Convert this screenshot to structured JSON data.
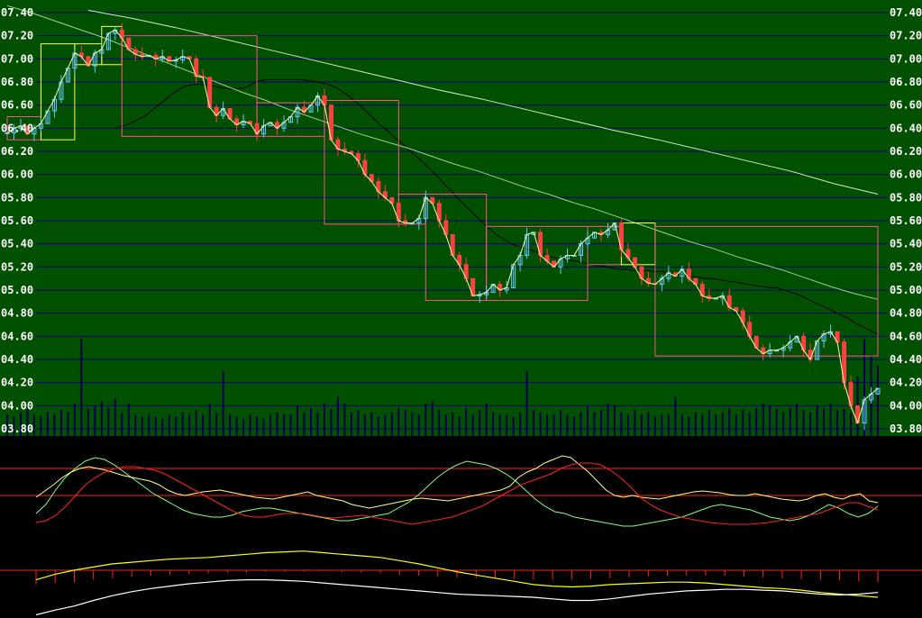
{
  "colors": {
    "price_bg": "#005000",
    "indicator_bg": "#000000",
    "gridline": "#00007a",
    "volume_bar": "#00004c",
    "candle_up": "#64c8ff",
    "candle_down": "#ff4040",
    "close_line": "#ffffa0",
    "ma_short": "#000000",
    "ma_long": "#a0d090",
    "ma_longest": "#d8e8c8",
    "box_up": "#ffff40",
    "box_down": "#ff5090",
    "kdj_k": "#ffff80",
    "kdj_d": "#ff2020",
    "kdj_j": "#80ff80",
    "macd_dif": "#ffffff",
    "macd_dea": "#ffff00",
    "macd_bar": "#ff2020",
    "ref_line": "#ff2020"
  },
  "chart_data": {
    "type": "line",
    "y_axis_left": {
      "ticks": [
        "07.40",
        "07.20",
        "07.00",
        "06.80",
        "06.60",
        "06.40",
        "06.20",
        "06.00",
        "05.80",
        "05.60",
        "05.40",
        "05.20",
        "05.00",
        "04.80",
        "04.60",
        "04.40",
        "04.20",
        "04.00",
        "03.80"
      ],
      "ylim": [
        3.8,
        7.4
      ]
    },
    "y_axis_right": {
      "ticks": [
        "07.40",
        "07.20",
        "07.00",
        "06.80",
        "06.60",
        "06.40",
        "06.20",
        "06.00",
        "05.80",
        "05.60",
        "05.40",
        "05.20",
        "05.00",
        "04.80",
        "04.60",
        "04.40",
        "04.20",
        "04.00",
        "03.80"
      ]
    },
    "grid": true,
    "close": [
      6.36,
      6.4,
      6.42,
      6.35,
      6.4,
      6.44,
      6.55,
      6.65,
      6.8,
      6.92,
      7.05,
      7.02,
      6.94,
      7.05,
      7.08,
      7.22,
      7.25,
      7.18,
      7.08,
      7.04,
      7.02,
      7.03,
      7.0,
      7.02,
      6.98,
      6.99,
      7.02,
      7.0,
      6.85,
      6.84,
      6.58,
      6.51,
      6.57,
      6.48,
      6.43,
      6.46,
      6.44,
      6.35,
      6.42,
      6.45,
      6.4,
      6.45,
      6.5,
      6.58,
      6.54,
      6.6,
      6.68,
      6.6,
      6.3,
      6.22,
      6.2,
      6.18,
      6.12,
      6.0,
      5.94,
      5.85,
      5.8,
      5.75,
      5.6,
      5.58,
      5.58,
      5.62,
      5.8,
      5.75,
      5.6,
      5.48,
      5.3,
      5.22,
      5.1,
      4.95,
      4.96,
      4.98,
      5.05,
      5.0,
      5.02,
      5.22,
      5.3,
      5.48,
      5.5,
      5.3,
      5.25,
      5.2,
      5.27,
      5.3,
      5.3,
      5.4,
      5.45,
      5.5,
      5.48,
      5.52,
      5.58,
      5.35,
      5.28,
      5.2,
      5.1,
      5.06,
      5.05,
      5.1,
      5.15,
      5.12,
      5.18,
      5.1,
      5.05,
      4.95,
      4.93,
      4.93,
      4.95,
      4.85,
      4.82,
      4.72,
      4.6,
      4.5,
      4.45,
      4.48,
      4.48,
      4.5,
      4.55,
      4.6,
      4.48,
      4.4,
      4.56,
      4.62,
      4.64,
      4.55,
      4.2,
      4.0,
      3.85,
      4.05,
      4.1,
      4.15
    ],
    "ma_short": [
      6.4,
      6.42,
      6.44,
      6.47,
      6.5,
      6.55,
      6.6,
      6.65,
      6.7,
      6.74,
      6.77,
      6.78,
      6.78,
      6.77,
      6.76,
      6.75,
      6.74,
      6.74,
      6.75,
      6.78,
      6.81,
      6.82,
      6.82,
      6.82,
      6.82,
      6.82,
      6.82,
      6.81,
      6.8,
      6.79,
      6.77,
      6.74,
      6.7,
      6.65,
      6.6,
      6.54,
      6.48,
      6.42,
      6.37,
      6.31,
      6.26,
      6.2,
      6.15,
      6.09,
      6.03,
      5.97,
      5.9,
      5.84,
      5.77,
      5.71,
      5.65,
      5.59,
      5.53,
      5.48,
      5.44,
      5.4,
      5.38,
      5.36,
      5.34,
      5.32,
      5.3,
      5.28,
      5.27,
      5.26,
      5.25,
      5.24,
      5.22,
      5.21,
      5.21,
      5.19,
      5.18,
      5.18,
      5.17,
      5.17,
      5.17,
      5.16,
      5.16,
      5.15,
      5.14,
      5.13,
      5.12,
      5.11,
      5.1,
      5.1,
      5.09,
      5.08,
      5.07,
      5.06,
      5.05,
      5.04,
      5.03,
      5.02,
      5.02,
      5.0,
      4.98,
      4.96,
      4.93,
      4.9,
      4.87,
      4.84,
      4.81,
      4.78,
      4.75,
      4.71,
      4.68,
      4.65,
      4.62
    ],
    "ma_short_offset": 16,
    "ma_long": [
      7.46,
      7.4,
      7.33,
      7.26,
      7.19,
      7.11,
      7.03,
      6.95,
      6.87,
      6.79,
      6.71,
      6.64,
      6.56,
      6.49,
      6.42,
      6.35,
      6.29,
      6.23,
      6.16,
      6.09,
      6.03,
      5.96,
      5.89,
      5.83,
      5.76,
      5.7,
      5.63,
      5.56,
      5.49,
      5.42,
      5.36,
      5.29,
      5.23,
      5.17,
      5.1,
      5.03,
      4.97,
      4.92
    ],
    "ma_long_offset": 40,
    "ma_longest": [
      7.42,
      7.35,
      7.27,
      7.18,
      7.09,
      7.0,
      6.91,
      6.82,
      6.73,
      6.65,
      6.56,
      6.47,
      6.38,
      6.3,
      6.21,
      6.12,
      6.03,
      5.92,
      5.83
    ],
    "ma_longest_offset": 84,
    "candle_highs_extra": 0.06,
    "volume_max_ref": 4.95,
    "volume": [
      0.2,
      0.18,
      0.22,
      0.25,
      0.2,
      0.18,
      0.22,
      0.2,
      0.24,
      0.22,
      0.3,
      0.9,
      0.25,
      0.28,
      0.32,
      0.26,
      0.35,
      0.22,
      0.3,
      0.2,
      0.18,
      0.2,
      0.18,
      0.16,
      0.2,
      0.18,
      0.22,
      0.2,
      0.24,
      0.2,
      0.3,
      0.22,
      0.6,
      0.2,
      0.18,
      0.16,
      0.2,
      0.18,
      0.16,
      0.2,
      0.22,
      0.2,
      0.2,
      0.28,
      0.22,
      0.26,
      0.22,
      0.3,
      0.25,
      0.36,
      0.3,
      0.22,
      0.24,
      0.2,
      0.22,
      0.18,
      0.2,
      0.22,
      0.26,
      0.24,
      0.22,
      0.2,
      0.3,
      0.32,
      0.24,
      0.2,
      0.22,
      0.18,
      0.26,
      0.2,
      0.24,
      0.3,
      0.22,
      0.2,
      0.2,
      0.18,
      0.22,
      0.6,
      0.24,
      0.22,
      0.2,
      0.2,
      0.24,
      0.2,
      0.18,
      0.22,
      0.28,
      0.22,
      0.24,
      0.3,
      0.28,
      0.22,
      0.2,
      0.24,
      0.2,
      0.22,
      0.18,
      0.2,
      0.2,
      0.36,
      0.2,
      0.18,
      0.22,
      0.2,
      0.24,
      0.2,
      0.22,
      0.26,
      0.2,
      0.24,
      0.22,
      0.26,
      0.3,
      0.28,
      0.25,
      0.22,
      0.26,
      0.3,
      0.24,
      0.22,
      0.28,
      0.26,
      0.3,
      0.24,
      0.25,
      0.22,
      0.55,
      0.9,
      0.75,
      0.65
    ],
    "box_segments": [
      {
        "from": 0,
        "to": 5,
        "low": 6.3,
        "high": 6.5,
        "dir": "down"
      },
      {
        "from": 5,
        "to": 10,
        "low": 6.3,
        "high": 7.13,
        "dir": "up"
      },
      {
        "from": 10,
        "to": 14,
        "low": 6.95,
        "high": 7.13,
        "dir": "up"
      },
      {
        "from": 14,
        "to": 17,
        "low": 6.95,
        "high": 7.28,
        "dir": "up"
      },
      {
        "from": 17,
        "to": 37,
        "low": 6.33,
        "high": 7.2,
        "dir": "down"
      },
      {
        "from": 37,
        "to": 47,
        "low": 6.33,
        "high": 6.62,
        "dir": "down"
      },
      {
        "from": 47,
        "to": 58,
        "low": 5.57,
        "high": 6.64,
        "dir": "down"
      },
      {
        "from": 58,
        "to": 62,
        "low": 5.57,
        "high": 5.83,
        "dir": "down"
      },
      {
        "from": 62,
        "to": 71,
        "low": 4.91,
        "high": 5.83,
        "dir": "down"
      },
      {
        "from": 71,
        "to": 86,
        "low": 4.91,
        "high": 5.55,
        "dir": "down"
      },
      {
        "from": 86,
        "to": 91,
        "low": 5.22,
        "high": 5.55,
        "dir": "down"
      },
      {
        "from": 91,
        "to": 96,
        "low": 5.22,
        "high": 5.58,
        "dir": "up"
      },
      {
        "from": 96,
        "to": 131,
        "low": 4.43,
        "high": 5.55,
        "dir": "down"
      },
      {
        "from": 131,
        "to": 134,
        "low": 4.43,
        "high": 4.65,
        "dir": "up"
      },
      {
        "from": 134,
        "to": 139,
        "low": 3.82,
        "high": 4.6,
        "dir": "down"
      }
    ],
    "kdj": {
      "ref_levels": [
        80,
        50
      ],
      "ylim": [
        0,
        110
      ],
      "k": [
        48,
        55,
        62,
        70,
        76,
        80,
        82,
        80,
        78,
        75,
        72,
        70,
        68,
        66,
        62,
        56,
        52,
        50,
        52,
        54,
        55,
        56,
        54,
        52,
        50,
        48,
        47,
        46,
        48,
        50,
        52,
        54,
        50,
        48,
        46,
        44,
        40,
        38,
        36,
        38,
        40,
        42,
        44,
        46,
        47,
        46,
        45,
        44,
        46,
        48,
        50,
        52,
        54,
        56,
        60,
        70,
        76,
        80,
        86,
        90,
        94,
        92,
        84,
        76,
        66,
        56,
        50,
        48,
        50,
        48,
        47,
        46,
        48,
        50,
        52,
        54,
        55,
        54,
        53,
        51,
        50,
        50,
        52,
        50,
        48,
        46,
        45,
        44,
        46,
        50,
        52,
        48,
        46,
        50,
        52,
        44,
        42
      ],
      "d": [
        20,
        22,
        28,
        38,
        50,
        62,
        70,
        76,
        80,
        82,
        82,
        80,
        78,
        74,
        68,
        62,
        56,
        50,
        44,
        38,
        32,
        28,
        26,
        26,
        28,
        30,
        30,
        30,
        28,
        26,
        25,
        26,
        27,
        28,
        26,
        24,
        22,
        20,
        18,
        20,
        22,
        24,
        26,
        30,
        34,
        38,
        44,
        50,
        56,
        62,
        66,
        70,
        74,
        80,
        84,
        86,
        86,
        84,
        78,
        70,
        60,
        48,
        40,
        34,
        30,
        26,
        24,
        22,
        20,
        19,
        18,
        18,
        18,
        19,
        20,
        22,
        24,
        26,
        28,
        30,
        34,
        38,
        42,
        42,
        38,
        34
      ],
      "j": [
        30,
        40,
        56,
        70,
        80,
        88,
        92,
        90,
        84,
        76,
        68,
        60,
        52,
        46,
        40,
        34,
        30,
        28,
        26,
        26,
        28,
        32,
        34,
        36,
        36,
        34,
        32,
        30,
        28,
        26,
        24,
        22,
        22,
        24,
        26,
        28,
        30,
        36,
        42,
        50,
        60,
        70,
        78,
        84,
        88,
        86,
        84,
        80,
        74,
        66,
        56,
        46,
        38,
        32,
        30,
        26,
        24,
        22,
        20,
        18,
        16,
        16,
        18,
        20,
        22,
        24,
        26,
        30,
        34,
        38,
        40,
        38,
        36,
        34,
        30,
        26,
        24,
        22,
        24,
        28,
        34,
        40,
        36,
        30,
        26,
        30,
        38
      ]
    },
    "macd": {
      "ref_level": 0,
      "ylim": [
        -0.6,
        0.35
      ],
      "dif": [
        -0.56,
        -0.5,
        -0.45,
        -0.38,
        -0.32,
        -0.27,
        -0.23,
        -0.2,
        -0.17,
        -0.15,
        -0.13,
        -0.12,
        -0.12,
        -0.13,
        -0.14,
        -0.16,
        -0.18,
        -0.2,
        -0.22,
        -0.24,
        -0.26,
        -0.28,
        -0.3,
        -0.31,
        -0.32,
        -0.33,
        -0.34,
        -0.36,
        -0.38,
        -0.38,
        -0.36,
        -0.33,
        -0.3,
        -0.28,
        -0.26,
        -0.25,
        -0.24,
        -0.24,
        -0.25,
        -0.26,
        -0.28,
        -0.3,
        -0.31,
        -0.3,
        -0.28
      ],
      "dea": [
        -0.12,
        -0.05,
        0.0,
        0.04,
        0.08,
        0.1,
        0.12,
        0.14,
        0.15,
        0.16,
        0.18,
        0.2,
        0.22,
        0.23,
        0.24,
        0.22,
        0.2,
        0.18,
        0.16,
        0.12,
        0.08,
        0.03,
        -0.02,
        -0.06,
        -0.1,
        -0.14,
        -0.18,
        -0.2,
        -0.21,
        -0.2,
        -0.18,
        -0.17,
        -0.16,
        -0.15,
        -0.15,
        -0.16,
        -0.18,
        -0.2,
        -0.22,
        -0.23,
        -0.25,
        -0.28,
        -0.3,
        -0.32,
        -0.34
      ],
      "hist": [
        -0.18,
        -0.16,
        -0.15,
        -0.12,
        -0.1,
        -0.08,
        -0.07,
        -0.06,
        -0.05,
        -0.04,
        -0.03,
        -0.03,
        -0.02,
        -0.02,
        -0.02,
        -0.01,
        -0.02,
        -0.03,
        -0.04,
        -0.06,
        -0.07,
        -0.08,
        -0.09,
        -0.1,
        -0.1,
        -0.11,
        -0.12,
        -0.12,
        -0.12,
        -0.11,
        -0.1,
        -0.09,
        -0.08,
        -0.07,
        -0.07,
        -0.07,
        -0.07,
        -0.08,
        -0.09,
        -0.1,
        -0.11,
        -0.12,
        -0.13,
        -0.14,
        -0.15
      ]
    }
  }
}
